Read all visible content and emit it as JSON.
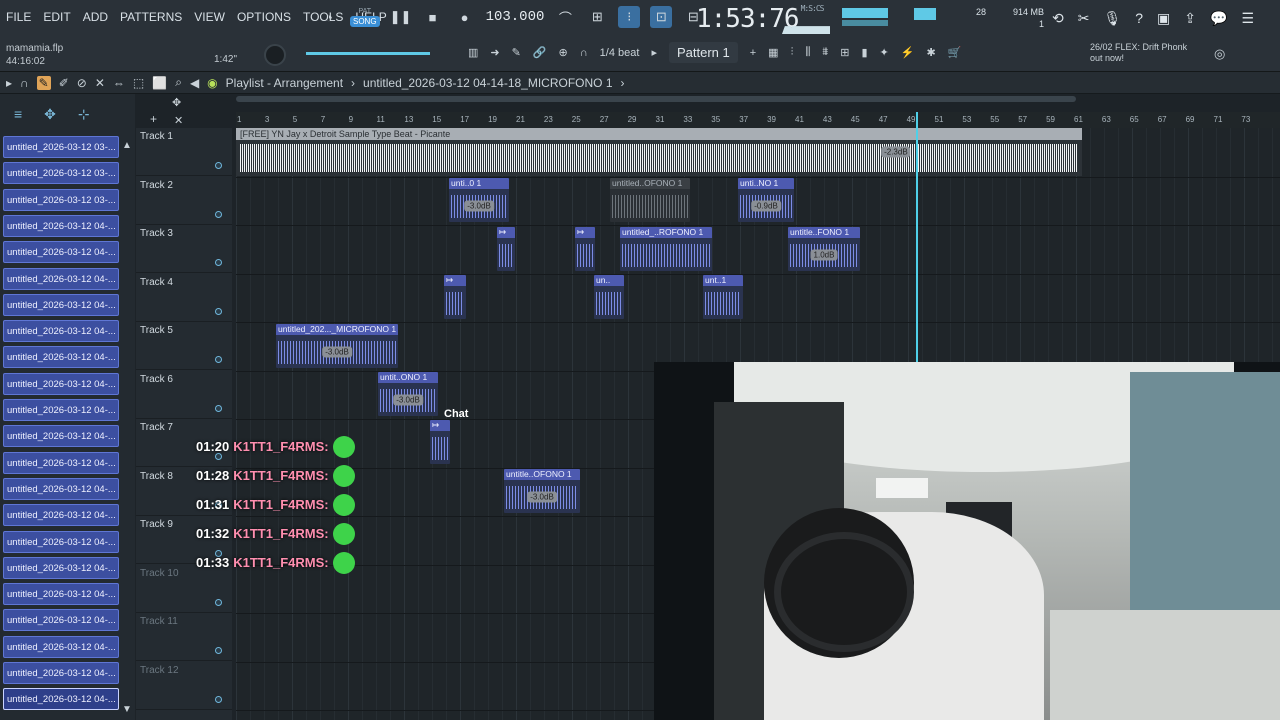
{
  "menu": [
    "FILE",
    "EDIT",
    "ADD",
    "PATTERNS",
    "VIEW",
    "OPTIONS",
    "TOOLS",
    "HELP"
  ],
  "file": {
    "name": "mamamia.flp",
    "time": "44:16:02"
  },
  "transport": {
    "mode": "SONG",
    "mode_top": "PAT",
    "tempo": "103.000",
    "position": "1:42\"",
    "snap": "1/4 beat",
    "play_icon": "pause-icon",
    "stop_icon": "stop-icon",
    "record_icon": "record-icon"
  },
  "clock": {
    "main": "1:53:76",
    "unit": "M:S:CS"
  },
  "stats": {
    "cpu_val": "28",
    "memory": "914 MB",
    "voices": "1"
  },
  "pattern": {
    "label": "Pattern 1"
  },
  "news": {
    "date": "26/02",
    "text": "FLEX: Drift Phonk",
    "sub": "out now!"
  },
  "breadcrumb": {
    "title": "Playlist - Arrangement",
    "separator": "›",
    "file": "untitled_2026-03-12 04-14-18_MICROFONO 1"
  },
  "sidebar_clips": [
    "untitled_2026-03-12 03-...",
    "untitled_2026-03-12 03-...",
    "untitled_2026-03-12 03-...",
    "untitled_2026-03-12 04-...",
    "untitled_2026-03-12 04-...",
    "untitled_2026-03-12 04-...",
    "untitled_2026-03-12 04-...",
    "untitled_2026-03-12 04-...",
    "untitled_2026-03-12 04-...",
    "untitled_2026-03-12 04-...",
    "untitled_2026-03-12 04-...",
    "untitled_2026-03-12 04-...",
    "untitled_2026-03-12 04-...",
    "untitled_2026-03-12 04-...",
    "untitled_2026-03-12 04-...",
    "untitled_2026-03-12 04-...",
    "untitled_2026-03-12 04-...",
    "untitled_2026-03-12 04-...",
    "untitled_2026-03-12 04-...",
    "untitled_2026-03-12 04-...",
    "untitled_2026-03-12 04-...",
    "untitled_2026-03-12 04-..."
  ],
  "tracks": [
    "Track 1",
    "Track 2",
    "Track 3",
    "Track 4",
    "Track 5",
    "Track 6",
    "Track 7",
    "Track 8",
    "Track 9",
    "Track 10",
    "Track 11",
    "Track 12"
  ],
  "ruler": [
    "1",
    "3",
    "5",
    "7",
    "9",
    "11",
    "13",
    "15",
    "17",
    "19",
    "21",
    "23",
    "25",
    "27",
    "29",
    "31",
    "33",
    "35",
    "37",
    "39",
    "41",
    "43",
    "45",
    "47",
    "49",
    "51",
    "53",
    "55",
    "57",
    "59",
    "61",
    "63",
    "65",
    "67",
    "69",
    "71",
    "73"
  ],
  "main_clip": {
    "title": "[FREE] YN Jay x Detroit Sample Type Beat - Picante",
    "gain": "-2.3dB"
  },
  "clips": {
    "t2a": {
      "label": "unti..0 1",
      "gain": "-3.0dB"
    },
    "t2b": {
      "label": "untitled..OFONO 1"
    },
    "t2c": {
      "label": "unti..NO 1",
      "gain": "-0.9dB"
    },
    "t3a": {
      "label": "untitled_..ROFONO 1"
    },
    "t3b": {
      "label": "untitle..FONO 1",
      "gain": "1.0dB"
    },
    "t4a": {
      "label": "un.."
    },
    "t4b": {
      "label": "unt..1"
    },
    "t5a": {
      "label": "untitled_202..._MICROFONO 1",
      "gain": "-3.0dB"
    },
    "t6a": {
      "label": "untit..ONO 1",
      "gain": "-3.0dB"
    },
    "t8a": {
      "label": "untitle..OFONO 1",
      "gain": "-3.0dB"
    }
  },
  "chat": {
    "label": "Chat",
    "messages": [
      {
        "time": "01:20",
        "user": "K1TT1_F4RMS:"
      },
      {
        "time": "01:28",
        "user": "K1TT1_F4RMS:"
      },
      {
        "time": "01:31",
        "user": "K1TT1_F4RMS:"
      },
      {
        "time": "01:32",
        "user": "K1TT1_F4RMS:"
      },
      {
        "time": "01:33",
        "user": "K1TT1_F4RMS:"
      }
    ]
  },
  "colors": {
    "accent": "#4fd0e8",
    "clip": "#4d5ab0",
    "emote": "#3ed34a"
  }
}
